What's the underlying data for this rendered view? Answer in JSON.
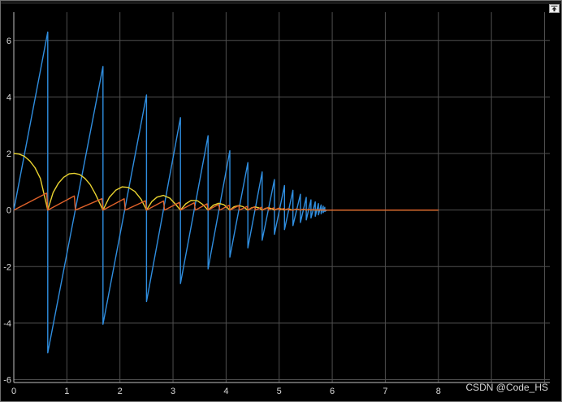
{
  "watermark": "CSDN @Code_HS",
  "toolbar": {
    "expand_icon": "expand-arrow-icon"
  },
  "colors": {
    "background": "#000000",
    "grid": "#4f4f4f",
    "axis": "#bfbfbf",
    "series1": "#2f8ee0",
    "series2": "#e8d230",
    "series3": "#e0622a"
  },
  "chart_data": {
    "type": "line",
    "title": "",
    "xlabel": "",
    "ylabel": "",
    "xlim": [
      0,
      10.1
    ],
    "ylim": [
      -6.1,
      7.0
    ],
    "x_ticks": [
      0,
      1,
      2,
      3,
      4,
      5,
      6,
      7,
      8
    ],
    "y_ticks": [
      -6,
      -4,
      -2,
      0,
      2,
      4,
      6
    ],
    "grid": true,
    "legend": "none",
    "series": [
      {
        "color": "#2f8ee0",
        "x": [
          0,
          0.64,
          0.64,
          1.68,
          1.68,
          2.5,
          2.5,
          3.14,
          3.14,
          3.66,
          3.66,
          4.07,
          4.07,
          4.41,
          4.41,
          4.68,
          4.68,
          4.91,
          4.91,
          5.1,
          5.1,
          5.26,
          5.26,
          5.4,
          5.4,
          5.51,
          5.51,
          5.6,
          5.6,
          5.68,
          5.68,
          5.74,
          5.74,
          5.79,
          5.79,
          5.83,
          5.83,
          5.86,
          5.86,
          5.9,
          8.0
        ],
        "y": [
          0,
          6.3,
          -5.05,
          5.08,
          -4.04,
          4.07,
          -3.24,
          3.27,
          -2.6,
          2.63,
          -2.08,
          2.1,
          -1.67,
          1.68,
          -1.34,
          1.35,
          -1.07,
          1.08,
          -0.86,
          0.87,
          -0.69,
          0.7,
          -0.55,
          0.56,
          -0.44,
          0.45,
          -0.35,
          0.36,
          -0.28,
          0.29,
          -0.22,
          0.23,
          -0.17,
          0.18,
          -0.13,
          0.14,
          -0.09,
          0.1,
          -0.05,
          0,
          0
        ]
      },
      {
        "color": "#e8d230",
        "x": [
          0,
          0.1,
          0.2,
          0.3,
          0.4,
          0.5,
          0.64,
          0.74,
          0.84,
          0.94,
          1.04,
          1.14,
          1.24,
          1.34,
          1.44,
          1.54,
          1.68,
          1.8,
          1.92,
          2.04,
          2.16,
          2.28,
          2.4,
          2.5,
          2.6,
          2.7,
          2.82,
          2.94,
          3.04,
          3.14,
          3.24,
          3.34,
          3.46,
          3.56,
          3.66,
          3.76,
          3.86,
          3.96,
          4.07,
          4.15,
          4.24,
          4.32,
          4.41,
          4.48,
          4.55,
          4.62,
          4.68,
          4.74,
          4.8,
          4.86,
          4.91,
          4.96,
          5.01,
          5.06,
          5.1,
          5.14,
          5.18,
          5.22,
          5.26,
          5.3,
          5.33,
          5.37,
          5.4,
          5.43,
          5.46,
          5.49,
          5.51,
          5.54,
          5.56,
          5.58,
          5.6,
          5.62,
          5.64,
          5.66,
          5.68,
          5.7,
          5.72,
          5.74,
          5.76,
          5.78,
          5.79,
          5.81,
          5.83,
          5.85,
          5.86,
          5.88,
          5.9,
          8.0
        ],
        "y": [
          2.0,
          1.98,
          1.9,
          1.74,
          1.5,
          1.12,
          0,
          0.62,
          0.95,
          1.16,
          1.28,
          1.3,
          1.26,
          1.12,
          0.9,
          0.56,
          0,
          0.45,
          0.7,
          0.82,
          0.8,
          0.66,
          0.38,
          0,
          0.3,
          0.46,
          0.52,
          0.42,
          0.22,
          0,
          0.22,
          0.34,
          0.33,
          0.2,
          0,
          0.17,
          0.24,
          0.19,
          0,
          0.12,
          0.16,
          0.12,
          0,
          0.08,
          0.11,
          0.08,
          0,
          0.06,
          0.08,
          0.05,
          0,
          0.04,
          0.05,
          0.03,
          0,
          0.03,
          0.04,
          0.02,
          0,
          0.02,
          0.03,
          0.02,
          0,
          0.015,
          0.02,
          0.01,
          0,
          0.01,
          0.015,
          0.01,
          0,
          0.01,
          0.01,
          0.005,
          0,
          0.005,
          0.008,
          0,
          0.004,
          0.005,
          0,
          0.003,
          0.003,
          0,
          0.002,
          0,
          0,
          0
        ]
      },
      {
        "color": "#e0622a",
        "x": [
          0,
          0.62,
          0.64,
          1.14,
          1.16,
          1.66,
          1.68,
          2.08,
          2.1,
          2.48,
          2.5,
          2.82,
          2.84,
          3.12,
          3.14,
          3.4,
          3.42,
          3.64,
          3.66,
          3.86,
          3.88,
          4.06,
          4.07,
          4.24,
          4.25,
          4.4,
          4.41,
          4.54,
          4.55,
          4.67,
          4.68,
          4.79,
          4.8,
          4.9,
          4.91,
          5.0,
          5.01,
          5.09,
          5.1,
          5.18,
          5.19,
          5.26,
          5.33,
          5.4,
          5.46,
          5.51,
          5.56,
          5.6,
          5.64,
          5.68,
          5.72,
          5.74,
          5.77,
          5.79,
          5.82,
          5.83,
          5.85,
          5.86,
          5.88,
          5.9,
          8.0
        ],
        "y": [
          0,
          0.6,
          0,
          0.5,
          0,
          0.4,
          0,
          0.4,
          0,
          0.33,
          0,
          0.32,
          0,
          0.27,
          0,
          0.26,
          0,
          0.22,
          0,
          0.2,
          0,
          0.17,
          0,
          0.16,
          0,
          0.13,
          0,
          0.12,
          0,
          0.1,
          0,
          0.09,
          0,
          0.08,
          0,
          0.07,
          0,
          0.06,
          0,
          0.05,
          0,
          0,
          0.04,
          0,
          0.03,
          0,
          0.025,
          0,
          0.02,
          0,
          0.015,
          0,
          0.01,
          0,
          0.008,
          0,
          0.005,
          0,
          0.003,
          0,
          0
        ]
      }
    ]
  }
}
